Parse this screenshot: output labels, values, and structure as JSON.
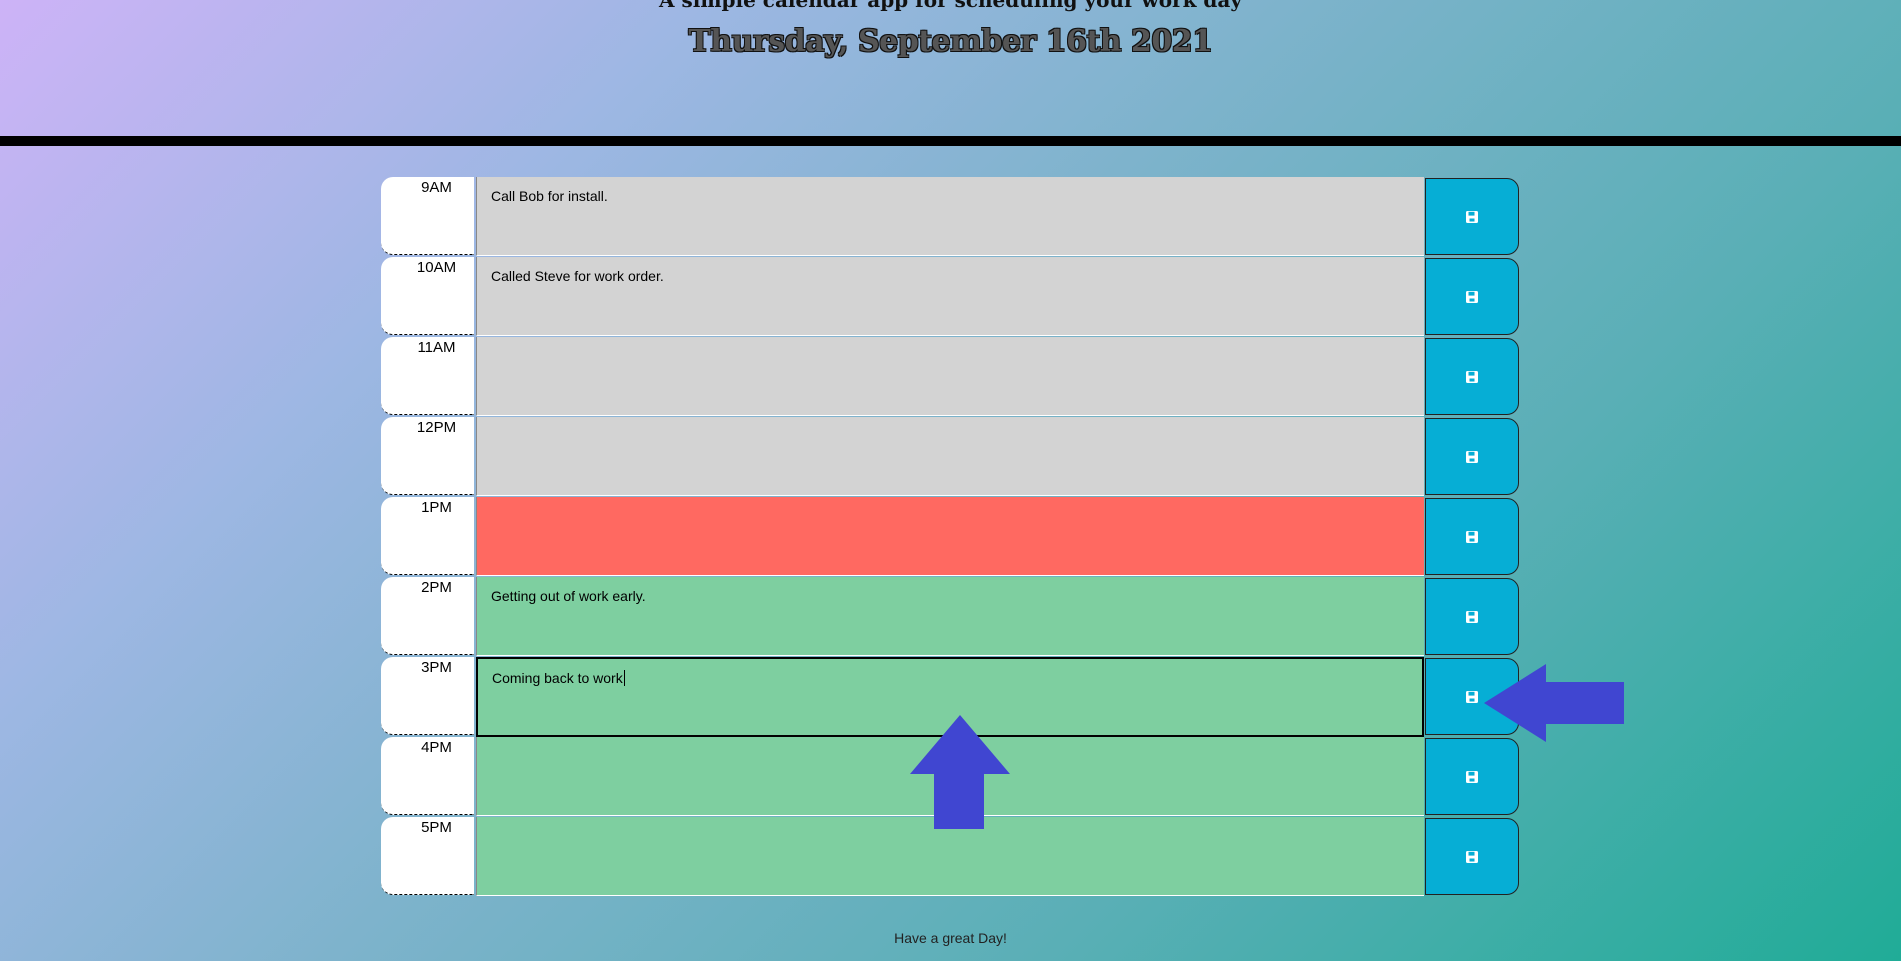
{
  "header": {
    "lead": "A simple calendar app for scheduling your work day",
    "current_day": "Thursday, September 16th 2021"
  },
  "rows": [
    {
      "hour": "9AM",
      "text": "Call Bob for install.",
      "state": "past"
    },
    {
      "hour": "10AM",
      "text": "Called Steve for work order.",
      "state": "past"
    },
    {
      "hour": "11AM",
      "text": "",
      "state": "past"
    },
    {
      "hour": "12PM",
      "text": "",
      "state": "past"
    },
    {
      "hour": "1PM",
      "text": "",
      "state": "present"
    },
    {
      "hour": "2PM",
      "text": "Getting out of work early.",
      "state": "future"
    },
    {
      "hour": "3PM",
      "text": "Coming back to work",
      "state": "future",
      "focused": true
    },
    {
      "hour": "4PM",
      "text": "",
      "state": "future"
    },
    {
      "hour": "5PM",
      "text": "",
      "state": "future"
    }
  ],
  "footer": {
    "text": "Have a great Day!"
  },
  "icons": {
    "save": "floppy-disk-icon",
    "annotation": "arrow-icon"
  },
  "colors": {
    "past": "#d3d3d3",
    "present": "#ff6961",
    "future": "#7ecfa0",
    "save_button": "#06aed5",
    "annotation_arrow": "#4046d1"
  }
}
